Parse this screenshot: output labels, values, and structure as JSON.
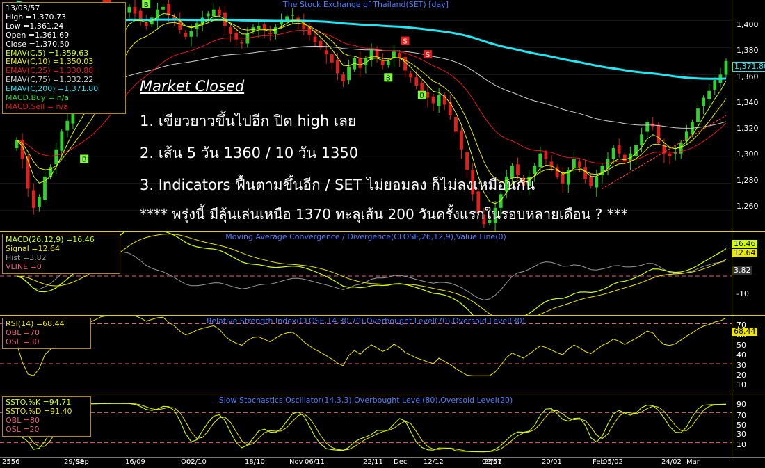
{
  "colors": {
    "up_candle": "#2fd22f",
    "down_candle": "#e0201e",
    "ema5": "#d4ff00",
    "ema10": "#e8e800",
    "ema25": "#e11b1b",
    "ema75": "#cfcfcf",
    "ema200": "#22e6f0",
    "macd_line": "#d4ff00",
    "signal_line": "#e8e800",
    "hist_line": "#9a9a9a",
    "rsi_line": "#f0e800",
    "stoch_k": "#d4ff00",
    "stoch_d": "#e8e800",
    "level_line": "#e0607a",
    "trend_line": "#ff3a3a",
    "panel_border": "#d8d000",
    "title_blue": "#4a7bff"
  },
  "price_panel": {
    "title": "The Stock Exchange of Thailand(SET) [day]",
    "info": {
      "date": "13/03/57",
      "high": "High =1,370.73",
      "low": "Low =1,361.24",
      "open": "Open =1,361.69",
      "close": "Close =1,370.50",
      "ema5": "EMAV(C,5)    =1,359.63",
      "ema10": "EMAV(C,10)   =1,350.03",
      "ema25": "EMAV(C,25)   =1,330.88",
      "ema75": "EMAV(C,75)   =1,332.22",
      "ema200": "EMAV(C,200)  =1,371.80",
      "macd_buy": "MACD.Buy  = n/a",
      "macd_sell": "MACD.Sell = n/a"
    },
    "annotation": {
      "heading": "Market Closed",
      "line1": "1. เขียวยาวขึ้นไปอีก ปิด high เลย",
      "line2": "2. เส้น 5 วัน 1360 / 10 วัน 1350",
      "line3": "3. Indicators ฟื้นตามขึ้นอีก / SET ไม่ยอมลง ก็ไม่ลงเหมือนกัน",
      "line4": "**** พรุ่งนี้ มีลุ้นเล่นเหนือ 1370 ทะลุเส้น 200 วันครั้งแรกในรอบหลายเดือน ? ***"
    },
    "y_ticks": [
      "1,400",
      "1,380",
      "1,360",
      "1,340",
      "1,320",
      "1,300",
      "1,280",
      "1,260"
    ],
    "last_value_tag": "1,371.80",
    "signal_b": "B",
    "signal_s": "S"
  },
  "macd_panel": {
    "title": "Moving Average Convergence / Divergence(CLOSE,26,12,9),Value Line(0)",
    "info": {
      "macd": "MACD(26,12,9)  =16.46",
      "signal": "Signal  =12.64",
      "hist": "Hist  =3.82",
      "vline": "VLINE  =0"
    },
    "y_ticks": [
      "-10"
    ],
    "tags": [
      "16.46",
      "12.64",
      "3.82"
    ]
  },
  "rsi_panel": {
    "title": "Relative Strength Index(CLOSE,14,30,70),Overbought Level(70),Oversold Level(30)",
    "info": {
      "rsi": "RSI(14)   =68.44",
      "obl": "OBL   =70",
      "osl": "OSL   =30"
    },
    "y_ticks": [
      "70",
      "60",
      "50",
      "40",
      "30",
      "20",
      "10"
    ],
    "tag": "68.44"
  },
  "stoch_panel": {
    "title": "Slow Stochastics Oscillator(14,3,3),Overbought Level(80),Oversold Level(20)",
    "info": {
      "k": "SSTO.%K   =94.71",
      "d": "SSTO.%D   =91.40",
      "obl": "OBL   =80",
      "osl": "OSL   =20"
    },
    "y_ticks": [
      "90",
      "70",
      "50",
      "30",
      "10"
    ]
  },
  "date_axis": {
    "labels": [
      "2556",
      "29/08",
      "Sep",
      "16/09",
      "Oct",
      "02/10",
      "18/10",
      "Nov",
      "06/11",
      "22/11",
      "Dec",
      "12/12",
      "02/01",
      "2557",
      "20/01",
      "Feb",
      "05/02",
      "24/02",
      "Mar"
    ]
  },
  "chart_data": [
    {
      "type": "candlestick",
      "title": "The Stock Exchange of Thailand(SET) [day]",
      "ylim": [
        1245,
        1415
      ],
      "x_range": [
        "2556-08 (late)",
        "2557-03-13"
      ],
      "last_bar": {
        "date": "13/03/57",
        "open": 1361.69,
        "high": 1370.73,
        "low": 1361.24,
        "close": 1370.5
      },
      "closes": [
        1312,
        1298,
        1276,
        1262,
        1270,
        1285,
        1292,
        1305,
        1318,
        1326,
        1334,
        1338,
        1345,
        1352,
        1361,
        1372,
        1385,
        1395,
        1398,
        1408,
        1410,
        1405,
        1400,
        1396,
        1402,
        1408,
        1410,
        1404,
        1400,
        1393,
        1388,
        1392,
        1398,
        1402,
        1405,
        1408,
        1404,
        1396,
        1390,
        1386,
        1383,
        1390,
        1395,
        1396,
        1393,
        1390,
        1395,
        1400,
        1403,
        1404,
        1400,
        1394,
        1389,
        1384,
        1380,
        1375,
        1369,
        1361,
        1355,
        1366,
        1372,
        1365,
        1372,
        1378,
        1373,
        1367,
        1370,
        1377,
        1372,
        1363,
        1358,
        1352,
        1348,
        1343,
        1339,
        1345,
        1338,
        1330,
        1318,
        1305,
        1290,
        1272,
        1258,
        1250,
        1253,
        1262,
        1272,
        1285,
        1293,
        1286,
        1278,
        1285,
        1293,
        1302,
        1298,
        1292,
        1285,
        1280,
        1290,
        1298,
        1292,
        1283,
        1278,
        1285,
        1293,
        1298,
        1306,
        1302,
        1296,
        1302,
        1308,
        1316,
        1325,
        1322,
        1310,
        1302,
        1300,
        1303,
        1310,
        1318,
        1325,
        1335,
        1343,
        1348,
        1356,
        1360,
        1370
      ],
      "ema_series": [
        {
          "name": "EMAV(C,5)",
          "last": 1359.63
        },
        {
          "name": "EMAV(C,10)",
          "last": 1350.03
        },
        {
          "name": "EMAV(C,25)",
          "last": 1330.88
        },
        {
          "name": "EMAV(C,75)",
          "last": 1332.22
        },
        {
          "name": "EMAV(C,200)",
          "last": 1371.8
        }
      ],
      "y_ticks": [
        1400,
        1380,
        1360,
        1340,
        1320,
        1300,
        1280,
        1260
      ]
    },
    {
      "type": "line",
      "title": "Moving Average Convergence / Divergence(CLOSE,26,12,9),Value Line(0)",
      "series": [
        {
          "name": "MACD(26,12,9)",
          "last": 16.46
        },
        {
          "name": "Signal",
          "last": 12.64
        },
        {
          "name": "Hist",
          "last": 3.82
        }
      ],
      "reference_line": 0
    },
    {
      "type": "line",
      "title": "Relative Strength Index(CLOSE,14,30,70),Overbought Level(70),Oversold Level(30)",
      "ylim": [
        0,
        80
      ],
      "series": [
        {
          "name": "RSI(14)",
          "last": 68.44
        }
      ],
      "levels": [
        70,
        30
      ]
    },
    {
      "type": "line",
      "title": "Slow Stochastics Oscillator(14,3,3),Overbought Level(80),Oversold Level(20)",
      "ylim": [
        0,
        100
      ],
      "series": [
        {
          "name": "SSTO.%K",
          "last": 94.71
        },
        {
          "name": "SSTO.%D",
          "last": 91.4
        }
      ],
      "levels": [
        80,
        20
      ]
    }
  ]
}
